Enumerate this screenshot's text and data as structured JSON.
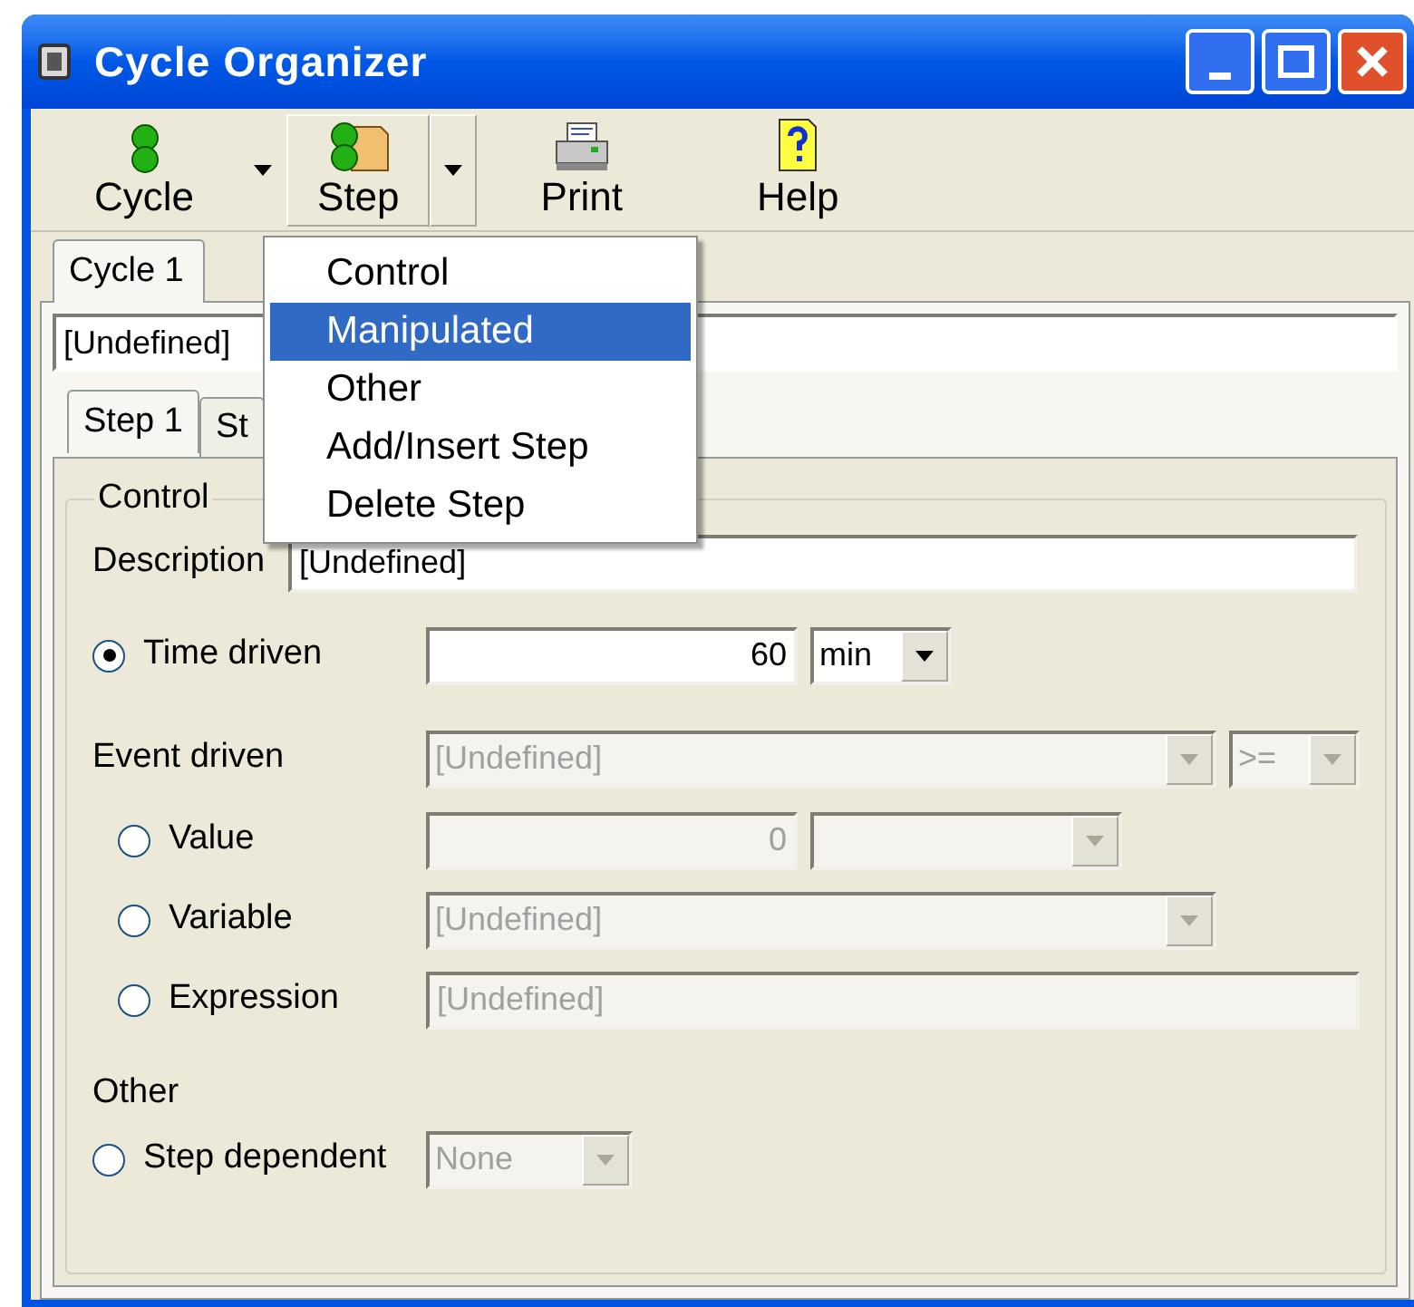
{
  "window": {
    "title": "Cycle Organizer"
  },
  "toolbar": [
    {
      "label": "Cycle",
      "kind": "cycle",
      "dropdown": true,
      "highlighted": false
    },
    {
      "label": "Step",
      "kind": "step",
      "dropdown": true,
      "highlighted": true
    },
    {
      "label": "Print",
      "kind": "print",
      "dropdown": false,
      "highlighted": false
    },
    {
      "label": "Help",
      "kind": "help",
      "dropdown": false,
      "highlighted": false
    }
  ],
  "cycle_tabs": [
    {
      "label": "Cycle 1",
      "selected": true
    }
  ],
  "cycle_name": {
    "value": "[Undefined]"
  },
  "step_tabs": [
    {
      "label": "Step 1",
      "selected": true
    },
    {
      "label": "St",
      "selected": false
    }
  ],
  "group": {
    "legend": "Control",
    "description": {
      "label": "Description",
      "value": "[Undefined]"
    },
    "time_driven": {
      "label": "Time driven",
      "selected": true,
      "value": "60",
      "unit": "min"
    },
    "event_driven": {
      "label": "Event driven",
      "source": "[Undefined]",
      "operator": ">=",
      "disabled": true
    },
    "event_options": [
      {
        "kind": "value",
        "label": "Value",
        "selected": false,
        "value": "0",
        "disabled": true
      },
      {
        "kind": "variable",
        "label": "Variable",
        "selected": false,
        "value": "[Undefined]",
        "disabled": true
      },
      {
        "kind": "expression",
        "label": "Expression",
        "selected": false,
        "value": "[Undefined]",
        "disabled": true
      }
    ],
    "other": {
      "label": "Other",
      "step_dependent": {
        "label": "Step dependent",
        "selected": false,
        "value": "None",
        "disabled": true
      }
    }
  },
  "menu": {
    "items": [
      {
        "label": "Control",
        "selected": false
      },
      {
        "label": "Manipulated",
        "selected": true
      },
      {
        "label": "Other",
        "selected": false
      },
      {
        "label": "Add/Insert Step",
        "selected": false
      },
      {
        "label": "Delete Step",
        "selected": false
      }
    ]
  }
}
